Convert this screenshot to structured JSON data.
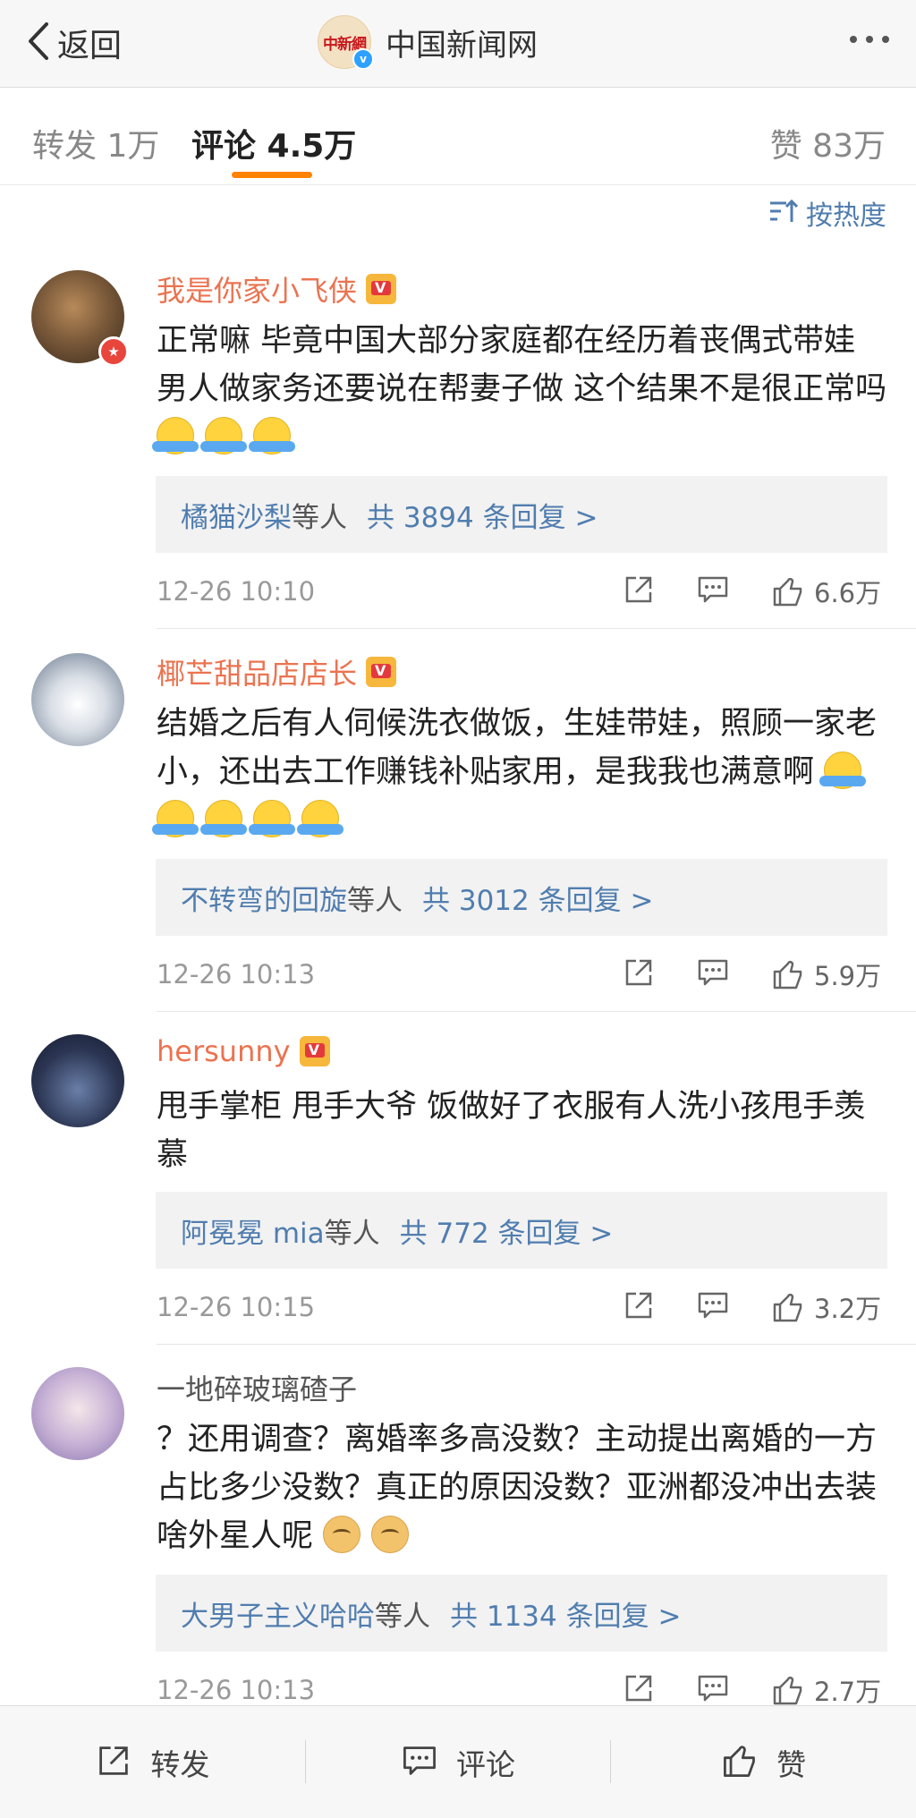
{
  "nav": {
    "back_label": "返回",
    "title": "中国新闻网",
    "logo_text": "中新網",
    "verified_glyph": "v"
  },
  "tabs": {
    "repost": "转发 1万",
    "comments": "评论 4.5万",
    "likes": "赞 83万"
  },
  "sort": {
    "label": "按热度"
  },
  "comments": [
    {
      "user": "我是你家小飞侠",
      "text": "正常嘛 毕竟中国大部分家庭都在经历着丧偶式带娃 男人做家务还要说在帮妻子做 这个结果不是很正常吗",
      "emoji": "shrug x3",
      "reply_user": "橘猫沙梨",
      "reply_mid": "等人",
      "reply_count": "共 3894 条回复 >",
      "time": "12-26 10:10",
      "likes": "6.6万"
    },
    {
      "user": "椰芒甜品店店长",
      "text": "结婚之后有人伺候洗衣做饭，生娃带娃，照顾一家老小，还出去工作赚钱补贴家用，是我我也满意啊",
      "emoji": "shrug x5",
      "reply_user": "不转弯的回旋",
      "reply_mid": "等人",
      "reply_count": "共 3012 条回复 >",
      "time": "12-26 10:13",
      "likes": "5.9万"
    },
    {
      "user": "hersunny",
      "text": "甩手掌柜 甩手大爷 饭做好了衣服有人洗小孩甩手羡慕",
      "reply_user": "阿冕冕 mia",
      "reply_mid": " 等人",
      "reply_count": "共 772 条回复 >",
      "time": "12-26 10:15",
      "likes": "3.2万"
    },
    {
      "user": "一地碎玻璃碴子",
      "text": "？还用调查？离婚率多高没数？主动提出离婚的一方占比多少没数？真正的原因没数？亚洲都没冲出去装啥外星人呢",
      "emoji": "doge x2",
      "reply_user": "大男子主义哈哈",
      "reply_mid": "等人",
      "reply_count": "共 1134 条回复 >",
      "time": "12-26 10:13",
      "likes": "2.7万"
    }
  ],
  "bottom": {
    "repost": "转发",
    "comment": "评论",
    "like": "赞"
  },
  "colors": {
    "username": "#eb7350",
    "link": "#507daf",
    "tab_indicator": "#ff8200"
  },
  "icons": [
    "chevron-left-icon",
    "more-icon",
    "sort-icon",
    "share-icon",
    "comment-icon",
    "like-icon",
    "crown-badge-icon",
    "shrug-emoji",
    "doge-emoji"
  ]
}
